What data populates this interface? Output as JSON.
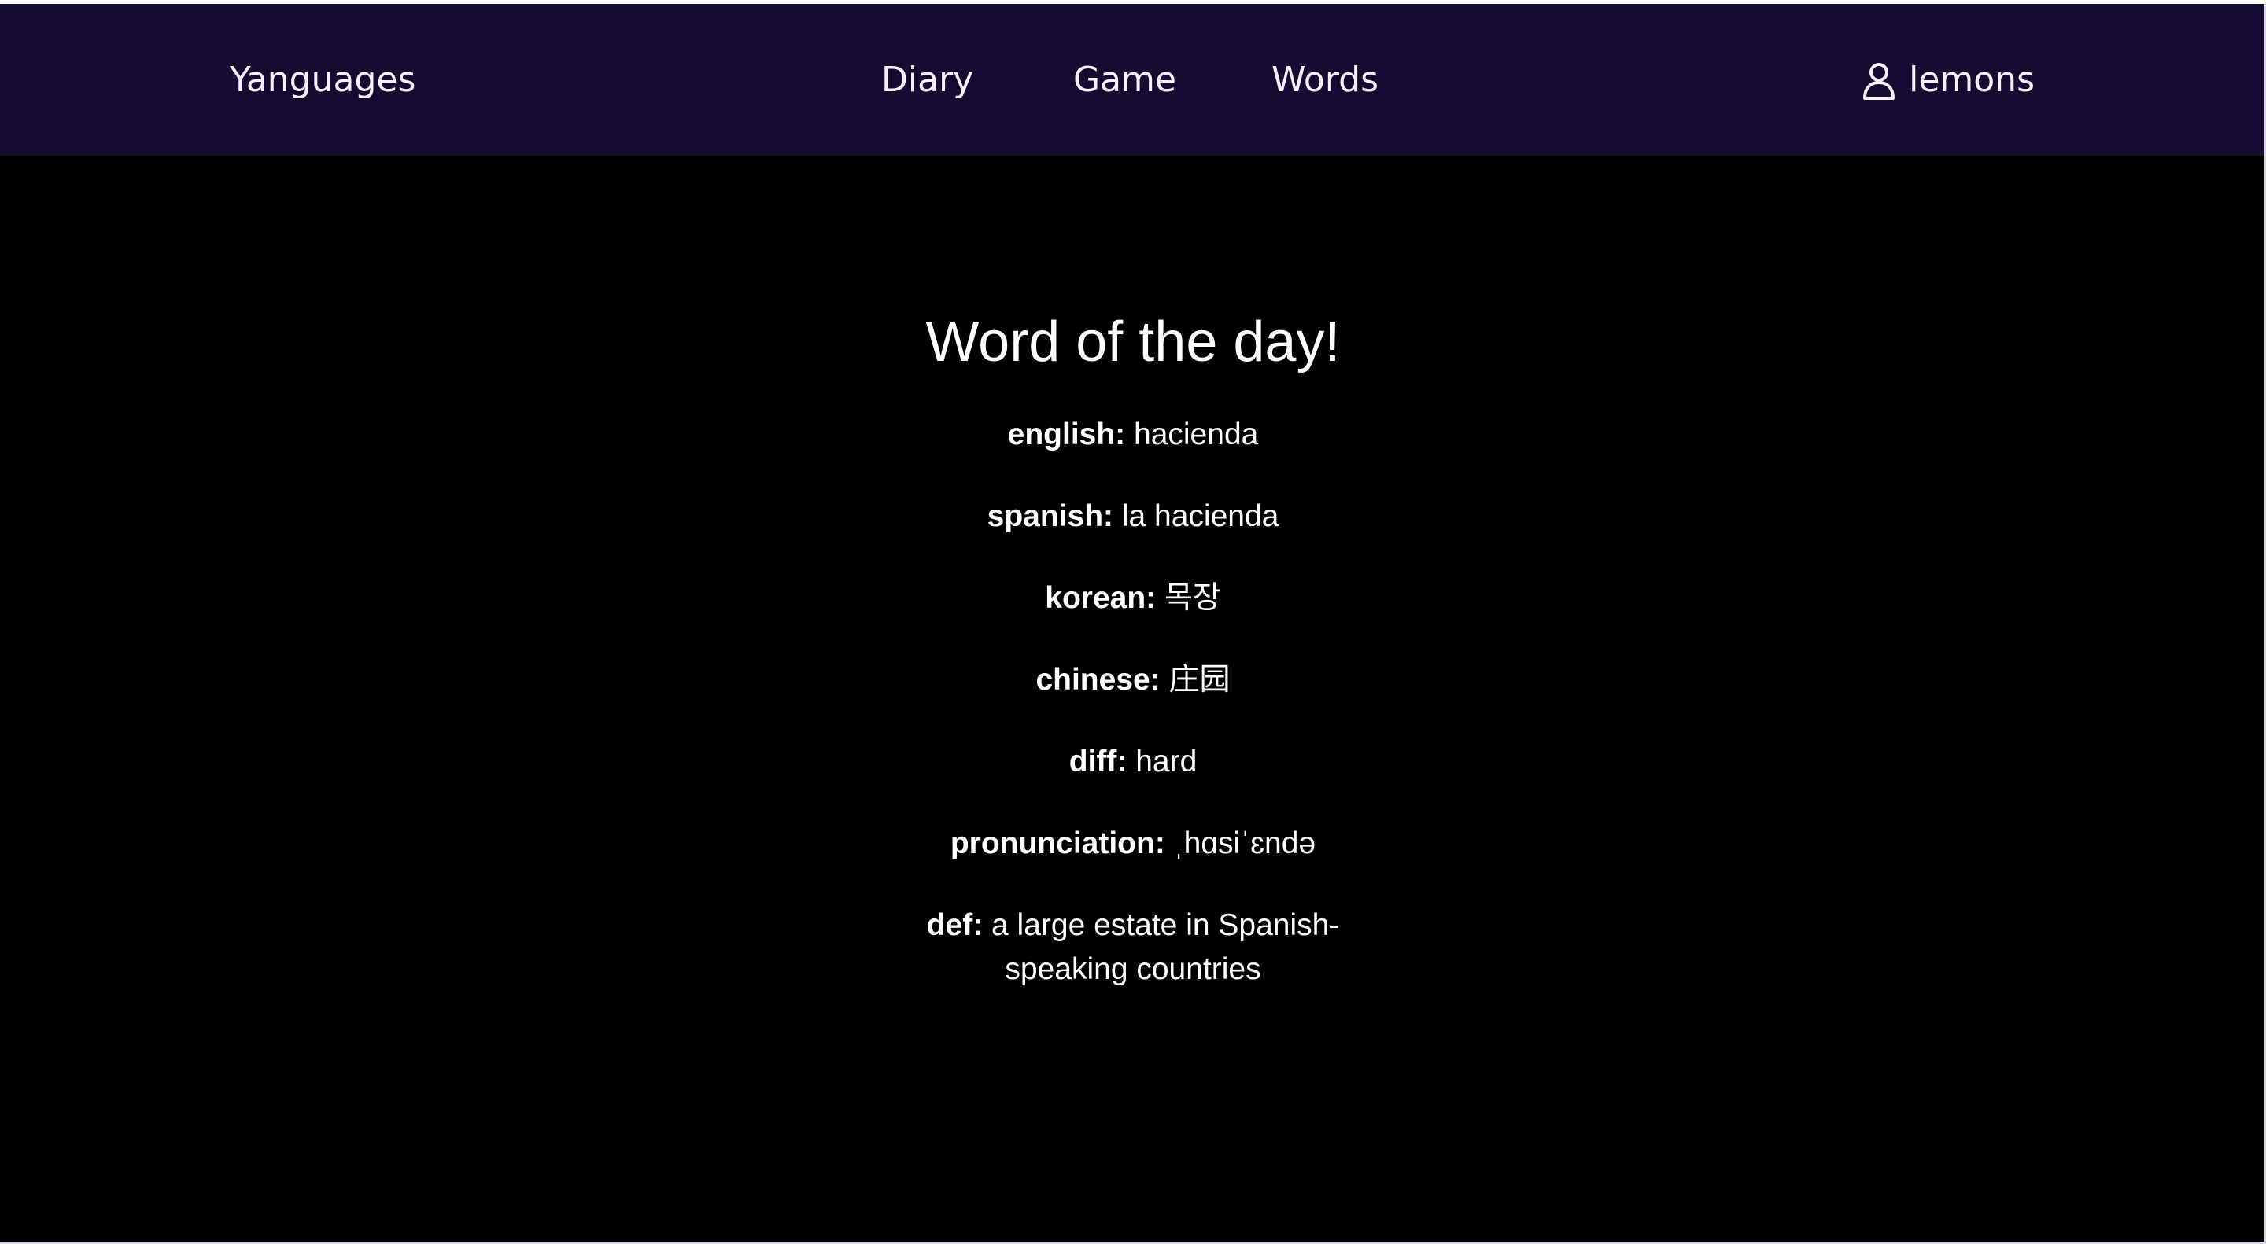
{
  "navbar": {
    "brand": "Yanguages",
    "links": [
      "Diary",
      "Game",
      "Words"
    ],
    "user": {
      "icon": "user-icon",
      "name": "lemons"
    }
  },
  "main": {
    "title": "Word of the day!",
    "entries": [
      {
        "label": "english:",
        "value": "hacienda"
      },
      {
        "label": "spanish:",
        "value": "la hacienda"
      },
      {
        "label": "korean:",
        "value": "목장"
      },
      {
        "label": "chinese:",
        "value": "庄园"
      },
      {
        "label": "diff:",
        "value": "hard"
      },
      {
        "label": "pronunciation:",
        "value": "ˌhɑsiˈɛndə"
      },
      {
        "label": "def:",
        "value": "a large estate in Spanish-speaking countries"
      }
    ]
  },
  "colors": {
    "navbar_bg": "#170b32",
    "page_bg": "#000000",
    "text": "#ffffff"
  }
}
